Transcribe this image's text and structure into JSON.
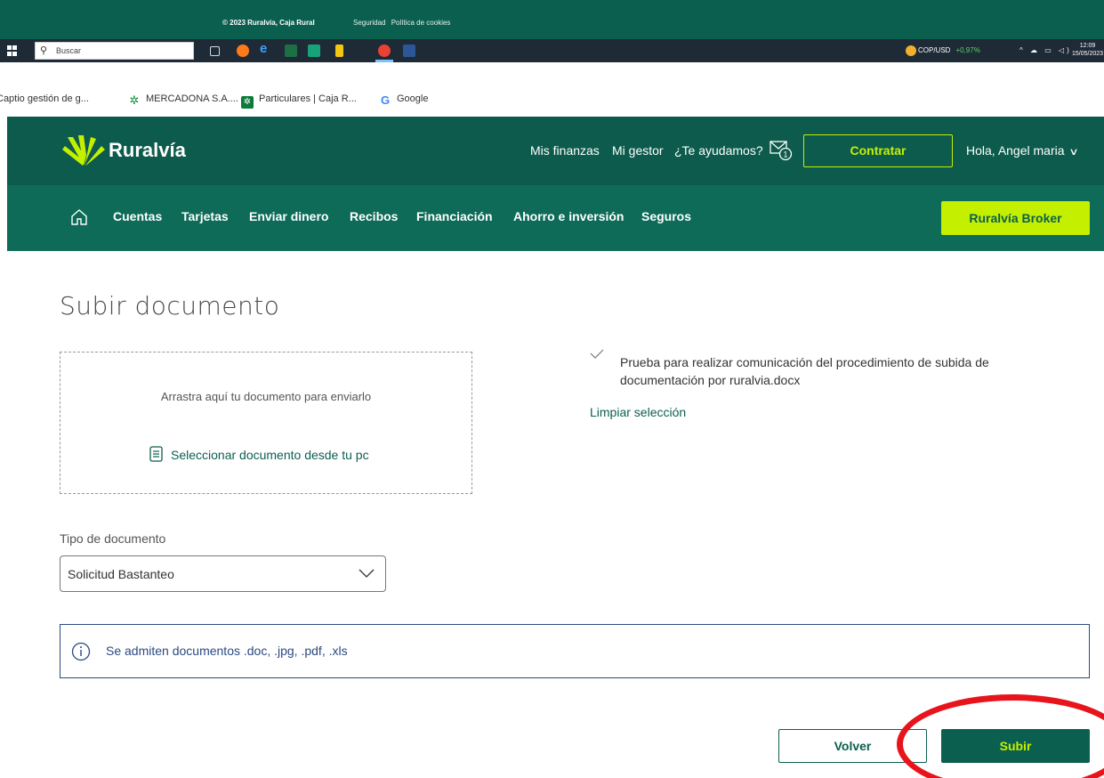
{
  "footer": {
    "copyright": "© 2023 Ruralvía, Caja Rural",
    "links": [
      "Seguridad",
      "Política de cookies"
    ]
  },
  "taskbar": {
    "search_placeholder": "Buscar",
    "ticker": "COP/USD",
    "ticker_change": "+0,97%",
    "time": "12:09",
    "date": "15/05/2023"
  },
  "bookmarks": [
    {
      "label": "Captio gestión de g...",
      "icon": "none"
    },
    {
      "label": "MERCADONA S.A....",
      "icon": "leaf-icon"
    },
    {
      "label": "Particulares | Caja R...",
      "icon": "caja-rural-icon"
    },
    {
      "label": "Google",
      "icon": "google-icon"
    }
  ],
  "header": {
    "brand": "Ruralvía",
    "links": [
      "Mis finanzas",
      "Mi gestor",
      "¿Te ayudamos?"
    ],
    "mail_count": "1",
    "contratar_label": "Contratar",
    "greeting": "Hola,",
    "user_name": "Angel maria"
  },
  "nav": {
    "items": [
      "Cuentas",
      "Tarjetas",
      "Enviar dinero",
      "Recibos",
      "Financiación",
      "Ahorro e inversión",
      "Seguros"
    ],
    "broker_label": "Ruralvía Broker"
  },
  "main": {
    "title": "Subir documento",
    "dropzone_hint": "Arrastra aquí tu documento para enviarlo",
    "select_from_pc": "Seleccionar documento desde tu pc",
    "selected_file": "Prueba para realizar comunicación del procedimiento de subida de documentación por ruralvia.docx",
    "clear_selection": "Limpiar selección",
    "doc_type_label": "Tipo de documento",
    "doc_type_value": "Solicitud Bastanteo",
    "info_message": "Se admiten documentos .doc, .jpg, .pdf, .xls",
    "back_label": "Volver",
    "upload_label": "Subir"
  },
  "colors": {
    "brand_dark": "#0b5f4e",
    "brand_nav": "#0d6b58",
    "accent_lime": "#c4f000",
    "info_blue": "#2b4a80",
    "annotation_red": "#e8141b"
  }
}
